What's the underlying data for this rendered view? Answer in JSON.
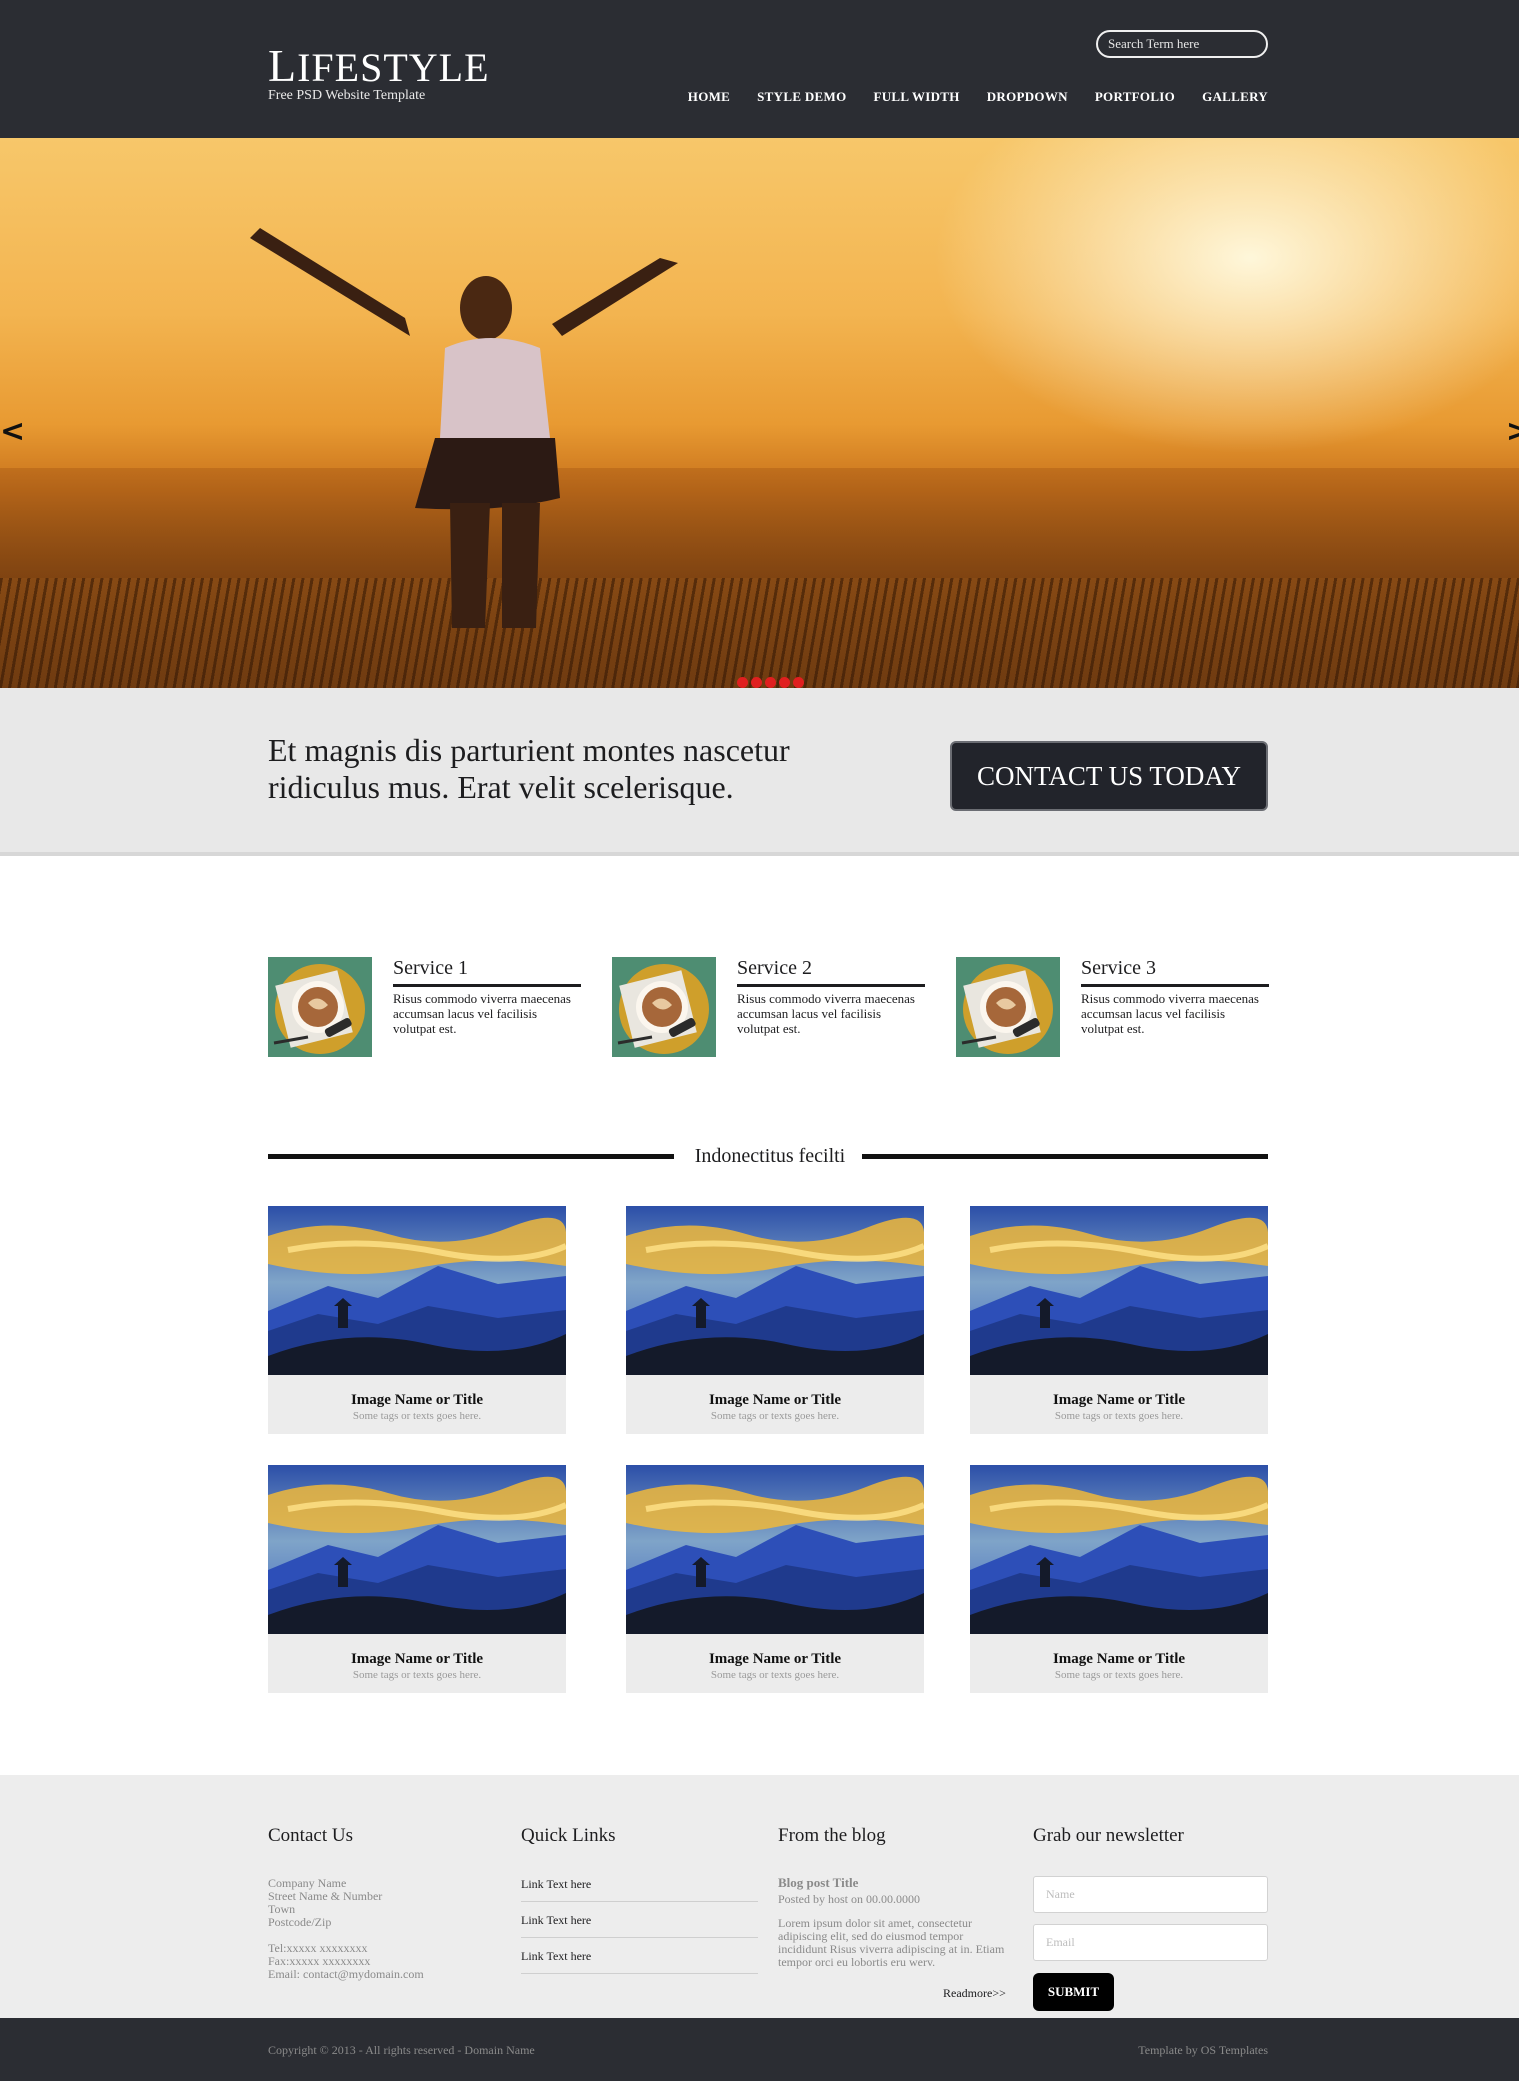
{
  "header": {
    "logo_title_first": "L",
    "logo_title_rest": "IFESTYLE",
    "logo_subtitle": "Free PSD Website Template",
    "search_placeholder": "Search Term here",
    "nav": [
      "HOME",
      "STYLE DEMO",
      "FULL WIDTH",
      "DROPDOWN",
      "PORTFOLIO",
      "GALLERY"
    ]
  },
  "slider": {
    "prev_glyph": "<",
    "next_glyph": ">",
    "dot_count": 5,
    "dot_color": "#e01f1f"
  },
  "cta": {
    "text": "Et magnis dis parturient montes nascetur ridiculus mus. Erat velit scelerisque.",
    "button": "CONTACT US TODAY"
  },
  "services": [
    {
      "title": "Service 1",
      "desc": "Risus commodo viverra maecenas accumsan lacus vel facilisis volutpat est.",
      "icon": "coffee-cup-image"
    },
    {
      "title": "Service 2",
      "desc": "Risus commodo viverra maecenas accumsan lacus vel facilisis volutpat est.",
      "icon": "coffee-cup-image"
    },
    {
      "title": "Service 3",
      "desc": "Risus commodo viverra maecenas accumsan lacus vel facilisis volutpat est.",
      "icon": "coffee-cup-image"
    }
  ],
  "gallery": {
    "heading": "Indonectitus fecilti",
    "items": [
      {
        "title": "Image Name or Title",
        "sub": "Some tags or texts goes here."
      },
      {
        "title": "Image Name or Title",
        "sub": "Some tags or texts goes here."
      },
      {
        "title": "Image Name or Title",
        "sub": "Some tags or texts goes here."
      },
      {
        "title": "Image Name or Title",
        "sub": "Some tags or texts goes here."
      },
      {
        "title": "Image Name or Title",
        "sub": "Some tags or texts goes here."
      },
      {
        "title": "Image Name or Title",
        "sub": "Some tags or texts goes here."
      }
    ]
  },
  "footer": {
    "contact_title": "Contact Us",
    "contact_lines": [
      "Company Name",
      "Street Name & Number",
      "Town",
      "Postcode/Zip"
    ],
    "contact_lines2": [
      "Tel:xxxxx xxxxxxxx",
      "Fax:xxxxx xxxxxxxx",
      "Email: contact@mydomain.com"
    ],
    "links_title": "Quick Links",
    "links": [
      "Link Text here",
      "Link Text here",
      "Link Text here"
    ],
    "blog_title": "From the blog",
    "blog_post_title": "Blog post Title",
    "blog_meta": "Posted by host on 00.00.0000",
    "blog_body": "Lorem ipsum dolor sit amet, consectetur adipiscing elit, sed do eiusmod tempor incididunt Risus viverra adipiscing at in. Etiam tempor orci eu lobortis eru werv.",
    "readmore": "Readmore>>",
    "newsletter_title": "Grab our newsletter",
    "name_placeholder": "Name",
    "email_placeholder": "Email",
    "submit": "SUBMIT",
    "copyright": "Copyright © 2013 - All rights reserved - Domain Name",
    "credit": "Template by OS Templates"
  },
  "colors": {
    "header_bg": "#2b2d33",
    "cta_bg": "#e8e8e8",
    "footer_bg": "#ededed"
  }
}
